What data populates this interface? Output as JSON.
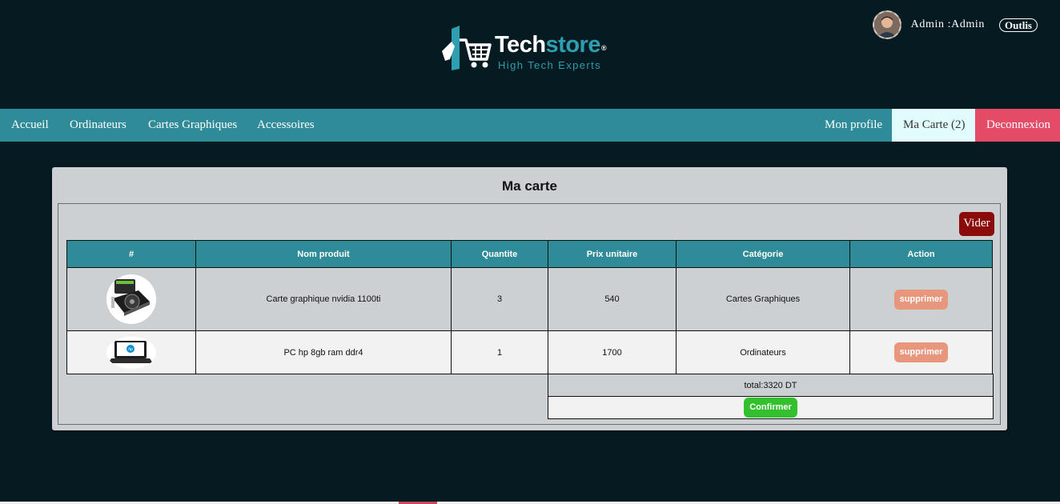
{
  "brand": {
    "name_part1": "Tech",
    "name_part2": "store",
    "registered": "®",
    "tagline": "High Tech Experts"
  },
  "user": {
    "label": "Admin :Admin",
    "tools_label": "Outlis"
  },
  "nav": {
    "home": "Accueil",
    "computers": "Ordinateurs",
    "graphics_cards": "Cartes Graphiques",
    "accessories": "Accessoires",
    "profile": "Mon profile",
    "cart": "Ma Carte (2)",
    "logout": "Deconnexion"
  },
  "colors": {
    "background": "#051a21",
    "nav": "#2e8b97",
    "cart_active": "#e0fcfc",
    "logout": "#e44b67",
    "empty_button": "#8b0a0a",
    "delete_button": "#e8977d",
    "confirm_button": "#32c12d"
  },
  "cart": {
    "title": "Ma carte",
    "empty_label": "Vider",
    "columns": [
      "#",
      "Nom produit",
      "Quantite",
      "Prix unitaire",
      "Catégorie",
      "Action"
    ],
    "rows": [
      {
        "image_icon": "graphics-card-thumbnail",
        "name": "Carte graphique nvidia 1100ti",
        "quantity": "3",
        "unit_price": "540",
        "category": "Cartes Graphiques",
        "action": "supprimer"
      },
      {
        "image_icon": "laptop-thumbnail",
        "name": "PC hp 8gb ram ddr4",
        "quantity": "1",
        "unit_price": "1700",
        "category": "Ordinateurs",
        "action": "supprimer"
      }
    ],
    "total": "total:3320 DT",
    "confirm_label": "Confirmer"
  }
}
